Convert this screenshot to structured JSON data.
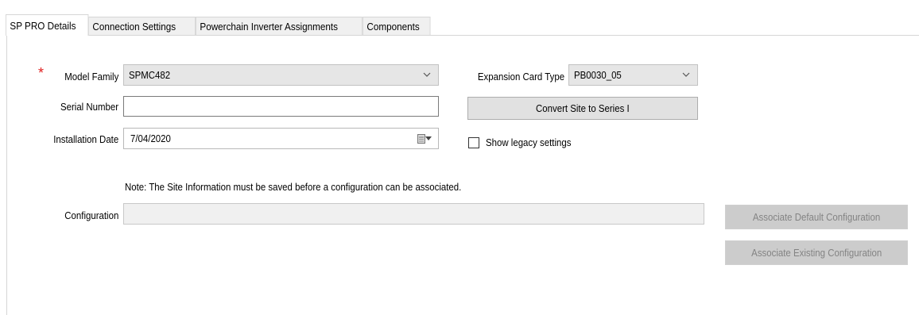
{
  "tabs": [
    {
      "label": "SP PRO Details",
      "active": true
    },
    {
      "label": "Connection Settings",
      "active": false
    },
    {
      "label": "Powerchain Inverter Assignments",
      "active": false
    },
    {
      "label": "Components",
      "active": false
    }
  ],
  "form": {
    "required_marker": "*",
    "model_family": {
      "label": "Model Family",
      "value": "SPMC482"
    },
    "serial_number": {
      "label": "Serial Number",
      "value": ""
    },
    "installation_date": {
      "label": "Installation Date",
      "value": "7/04/2020"
    },
    "expansion_card_type": {
      "label": "Expansion Card Type",
      "value": "PB0030_05"
    },
    "convert_button": "Convert Site to  Series I",
    "show_legacy": {
      "label": "Show legacy settings",
      "checked": false
    },
    "note": "Note: The Site Information must be saved before a configuration can be associated.",
    "configuration": {
      "label": "Configuration",
      "value": ""
    },
    "associate_default_button": "Associate Default Configuration",
    "associate_existing_button": "Associate Existing Configuration"
  },
  "colors": {
    "required": "#e02020",
    "disabled_button_bg": "#cccccc",
    "disabled_text": "#838383",
    "combo_bg": "#e6e6e6"
  },
  "icons": {
    "dropdown": "chevron-down-icon",
    "calendar": "calendar-icon"
  }
}
